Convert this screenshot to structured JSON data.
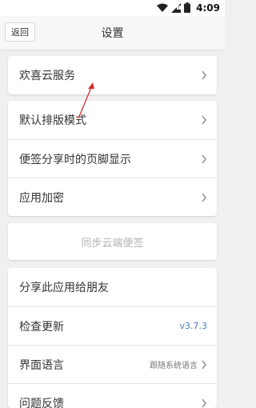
{
  "status_bar": {
    "time": "4:09",
    "icons": [
      "wifi-icon",
      "signal-icon",
      "battery-icon"
    ]
  },
  "header": {
    "back_label": "返回",
    "title": "设置"
  },
  "section1": {
    "items": [
      {
        "label": "欢喜云服务"
      }
    ]
  },
  "section2": {
    "items": [
      {
        "label": "默认排版模式"
      },
      {
        "label": "便签分享时的页脚显示"
      },
      {
        "label": "应用加密"
      }
    ]
  },
  "sync": {
    "label": "同步云端便签"
  },
  "section3": {
    "items": [
      {
        "label": "分享此应用给朋友"
      },
      {
        "label": "检查更新",
        "value": "v3.7.3"
      },
      {
        "label": "界面语言",
        "value": "跟随系统语言"
      },
      {
        "label": "问题反馈"
      }
    ]
  },
  "colors": {
    "background": "#f0f0f0",
    "annotation_arrow": "#d32f2f",
    "version_text": "#4a7fc0"
  }
}
